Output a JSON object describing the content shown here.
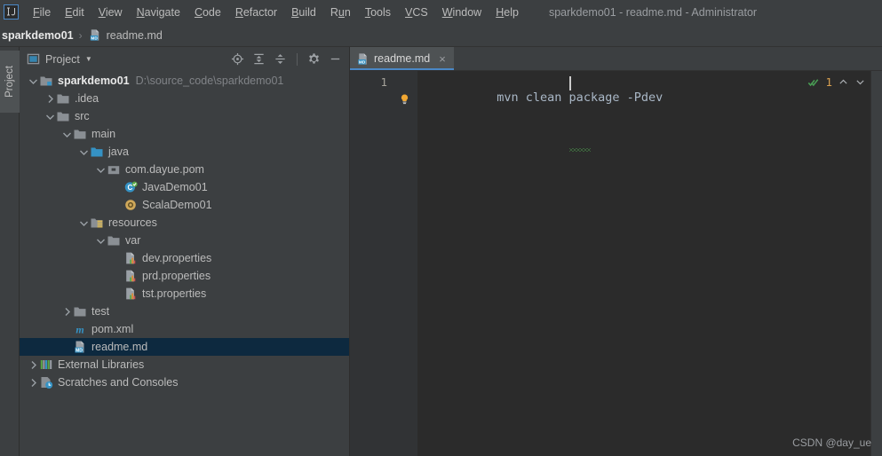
{
  "window": {
    "title": "sparkdemo01 - readme.md - Administrator",
    "logo_label": "IJ"
  },
  "menubar": {
    "items": [
      {
        "name": "file",
        "label": "File",
        "mnemonic": "F"
      },
      {
        "name": "edit",
        "label": "Edit",
        "mnemonic": "E"
      },
      {
        "name": "view",
        "label": "View",
        "mnemonic": "V"
      },
      {
        "name": "navigate",
        "label": "Navigate",
        "mnemonic": "N"
      },
      {
        "name": "code",
        "label": "Code",
        "mnemonic": "C"
      },
      {
        "name": "refactor",
        "label": "Refactor",
        "mnemonic": "R"
      },
      {
        "name": "build",
        "label": "Build",
        "mnemonic": "B"
      },
      {
        "name": "run",
        "label": "Run",
        "mnemonic": "u"
      },
      {
        "name": "tools",
        "label": "Tools",
        "mnemonic": "T"
      },
      {
        "name": "vcs",
        "label": "VCS",
        "mnemonic": "V"
      },
      {
        "name": "window",
        "label": "Window",
        "mnemonic": "W"
      },
      {
        "name": "help",
        "label": "Help",
        "mnemonic": "H"
      }
    ]
  },
  "breadcrumb": {
    "root": "sparkdemo01",
    "separator": "›",
    "file": "readme.md"
  },
  "sidebar_stripe": {
    "project_button": "Project"
  },
  "project_panel": {
    "title": "Project",
    "dropdown_caret": "▼",
    "tools": [
      {
        "name": "select-opened-file-icon",
        "tooltip": "Select Opened File"
      },
      {
        "name": "expand-all-icon",
        "tooltip": "Expand All"
      },
      {
        "name": "collapse-all-icon",
        "tooltip": "Collapse All"
      },
      {
        "name": "gear-icon",
        "tooltip": "Settings"
      },
      {
        "name": "minimize-icon",
        "tooltip": "Hide"
      }
    ],
    "tree": [
      {
        "name": "node-sparkdemo01",
        "label": "sparkdemo01",
        "hint": "D:\\source_code\\sparkdemo01",
        "icon": "module-folder-icon",
        "indent": 0,
        "arrow": "down",
        "bold": true,
        "selected": false
      },
      {
        "name": "node-idea",
        "label": ".idea",
        "hint": "",
        "icon": "folder-icon",
        "indent": 1,
        "arrow": "right",
        "bold": false,
        "selected": false
      },
      {
        "name": "node-src",
        "label": "src",
        "hint": "",
        "icon": "folder-icon",
        "indent": 1,
        "arrow": "down",
        "bold": false,
        "selected": false
      },
      {
        "name": "node-main",
        "label": "main",
        "hint": "",
        "icon": "folder-icon",
        "indent": 2,
        "arrow": "down",
        "bold": false,
        "selected": false
      },
      {
        "name": "node-java",
        "label": "java",
        "hint": "",
        "icon": "source-root-icon",
        "indent": 3,
        "arrow": "down",
        "bold": false,
        "selected": false
      },
      {
        "name": "node-com-dayue-pom",
        "label": "com.dayue.pom",
        "hint": "",
        "icon": "package-icon",
        "indent": 4,
        "arrow": "down",
        "bold": false,
        "selected": false
      },
      {
        "name": "node-javademo01",
        "label": "JavaDemo01",
        "hint": "",
        "icon": "java-class-icon",
        "indent": 5,
        "arrow": "none",
        "bold": false,
        "selected": false
      },
      {
        "name": "node-scalademo01",
        "label": "ScalaDemo01",
        "hint": "",
        "icon": "scala-object-icon",
        "indent": 5,
        "arrow": "none",
        "bold": false,
        "selected": false
      },
      {
        "name": "node-resources",
        "label": "resources",
        "hint": "",
        "icon": "resource-root-icon",
        "indent": 3,
        "arrow": "down",
        "bold": false,
        "selected": false
      },
      {
        "name": "node-var",
        "label": "var",
        "hint": "",
        "icon": "folder-icon",
        "indent": 4,
        "arrow": "down",
        "bold": false,
        "selected": false
      },
      {
        "name": "node-dev-properties",
        "label": "dev.properties",
        "hint": "",
        "icon": "properties-file-icon",
        "indent": 5,
        "arrow": "none",
        "bold": false,
        "selected": false
      },
      {
        "name": "node-prd-properties",
        "label": "prd.properties",
        "hint": "",
        "icon": "properties-file-icon",
        "indent": 5,
        "arrow": "none",
        "bold": false,
        "selected": false
      },
      {
        "name": "node-tst-properties",
        "label": "tst.properties",
        "hint": "",
        "icon": "properties-file-icon",
        "indent": 5,
        "arrow": "none",
        "bold": false,
        "selected": false
      },
      {
        "name": "node-test",
        "label": "test",
        "hint": "",
        "icon": "folder-icon",
        "indent": 2,
        "arrow": "right",
        "bold": false,
        "selected": false
      },
      {
        "name": "node-pom-xml",
        "label": "pom.xml",
        "hint": "",
        "icon": "maven-icon",
        "indent": 2,
        "arrow": "none",
        "bold": false,
        "selected": false
      },
      {
        "name": "node-readme-md",
        "label": "readme.md",
        "hint": "",
        "icon": "markdown-icon",
        "indent": 2,
        "arrow": "none",
        "bold": false,
        "selected": true
      },
      {
        "name": "node-external-libraries",
        "label": "External Libraries",
        "hint": "",
        "icon": "libraries-icon",
        "indent": 0,
        "arrow": "right",
        "bold": false,
        "selected": false
      },
      {
        "name": "node-scratches",
        "label": "Scratches and Consoles",
        "hint": "",
        "icon": "scratches-icon",
        "indent": 0,
        "arrow": "right",
        "bold": false,
        "selected": false
      }
    ]
  },
  "editor": {
    "tab": {
      "label": "readme.md",
      "icon": "markdown-icon",
      "close_label": "×"
    },
    "line_numbers": [
      "1"
    ],
    "code_text": "mvn clean package -Pdev",
    "caret_after_chars": 20,
    "squiggle_start_chars": 20,
    "squiggle_len_chars": 3,
    "intention_bulb": "lightbulb-icon",
    "inspection": {
      "status_icon": "inspection-ok-icon",
      "count": "1",
      "prev_label": "⌃",
      "next_label": "⌄"
    }
  },
  "watermark": "CSDN @day_ue",
  "colors": {
    "panel_bg": "#3c3f41",
    "editor_bg": "#2b2b2b",
    "gutter_bg": "#313335",
    "selection_bg": "#0d293f",
    "accent_blue": "#4a88c7",
    "code_fg": "#a9b7c6",
    "text_fg": "#bbbbbb",
    "hint_fg": "#808387",
    "warning_orange": "#d8a050",
    "ok_green": "#499c54"
  }
}
